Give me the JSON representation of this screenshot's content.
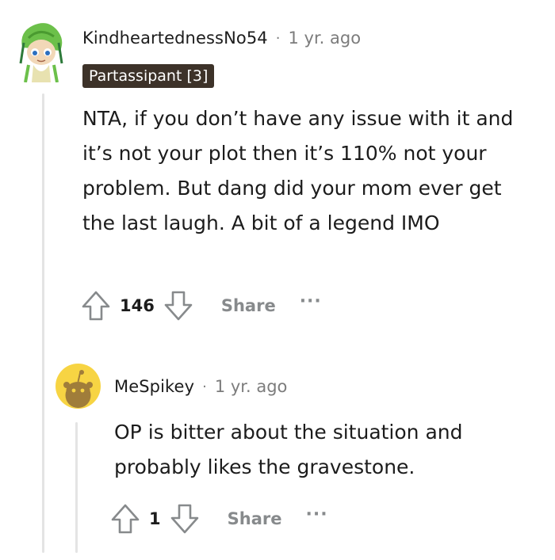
{
  "comment": {
    "author": "KindheartednessNo54",
    "separator": "·",
    "time": "1 yr. ago",
    "flair": "Partassipant [3]",
    "body": "NTA, if you don’t have any issue with it and it’s not your plot then it’s 110% not your problem. But dang did your mom ever get the last laugh. A bit of a legend IMO",
    "score": "146",
    "share_label": "Share",
    "more_label": "···"
  },
  "reply": {
    "author": "MeSpikey",
    "separator": "·",
    "time": "1 yr. ago",
    "body": "OP is bitter about the situation and probably likes the gravestone.",
    "score": "1",
    "share_label": "Share",
    "more_label": "···"
  },
  "icons": {
    "upvote": "upvote-arrow-icon",
    "downvote": "downvote-arrow-icon",
    "more": "more-dots-icon"
  },
  "colors": {
    "flair_bg": "#3d3229",
    "reply_avatar_bg": "#f7d443",
    "muted_text": "#7c7c7c",
    "thread_line": "#e4e4e4"
  }
}
